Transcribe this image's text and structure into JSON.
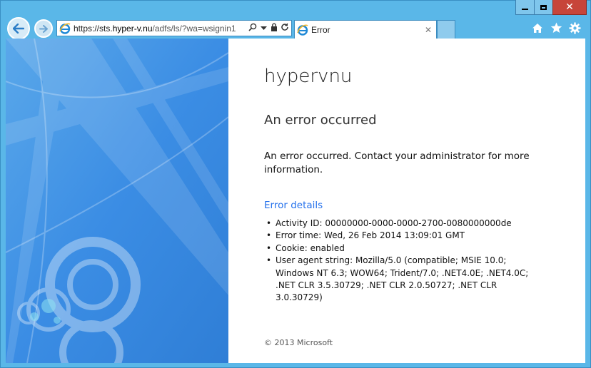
{
  "browser": {
    "url_scheme": "https://sts.",
    "url_domain": "hyper-v.nu",
    "url_path": "/adfs/ls/?wa=wsignin1",
    "tab_title": "Error"
  },
  "icons": {
    "back": "back-arrow-icon",
    "forward": "forward-arrow-icon",
    "search": "search-icon",
    "dropdown": "chevron-down-icon",
    "lock": "lock-icon",
    "refresh": "refresh-icon",
    "tab_close": "close-icon",
    "home": "home-icon",
    "favorites": "star-icon",
    "tools": "gear-icon"
  },
  "colors": {
    "chrome": "#5ab7e8",
    "accent_link": "#2672ec",
    "illustration": "#3d8fe3"
  },
  "page": {
    "company_name": "hypervnu",
    "error_title": "An error occurred",
    "error_message": "An error occurred. Contact your administrator for more information.",
    "details_link": "Error details",
    "details": [
      "Activity ID: 00000000-0000-0000-2700-0080000000de",
      "Error time: Wed, 26 Feb 2014 13:09:01 GMT",
      "Cookie: enabled",
      "User agent string: Mozilla/5.0 (compatible; MSIE 10.0; Windows NT 6.3; WOW64; Trident/7.0; .NET4.0E; .NET4.0C; .NET CLR 3.5.30729; .NET CLR 2.0.50727; .NET CLR 3.0.30729)"
    ],
    "copyright": "© 2013 Microsoft"
  }
}
